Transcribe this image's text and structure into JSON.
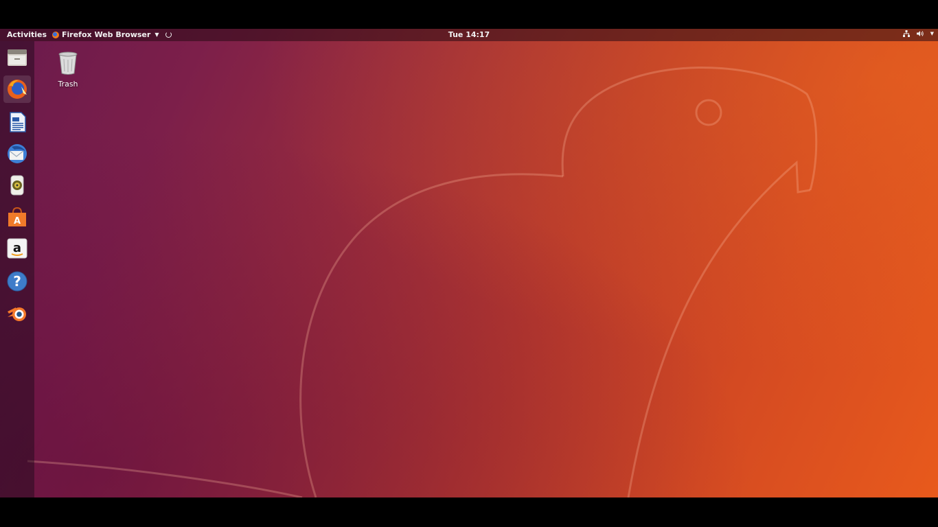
{
  "topbar": {
    "activities_label": "Activities",
    "app_menu_label": "Firefox Web Browser",
    "clock": "Tue 14:17"
  },
  "dock": {
    "items": [
      {
        "name": "files",
        "icon": "files-icon"
      },
      {
        "name": "firefox",
        "icon": "firefox-icon",
        "active": true
      },
      {
        "name": "libreoffice-writer",
        "icon": "writer-icon"
      },
      {
        "name": "thunderbird",
        "icon": "thunderbird-icon"
      },
      {
        "name": "rhythmbox",
        "icon": "rhythmbox-icon"
      },
      {
        "name": "ubuntu-software",
        "icon": "software-icon"
      },
      {
        "name": "amazon",
        "icon": "amazon-icon"
      },
      {
        "name": "help",
        "icon": "help-icon"
      },
      {
        "name": "blender",
        "icon": "blender-icon"
      }
    ]
  },
  "desktop": {
    "trash_label": "Trash"
  },
  "colors": {
    "wallpaper_dark": "#6a1a4c",
    "wallpaper_light": "#e85a1c"
  }
}
